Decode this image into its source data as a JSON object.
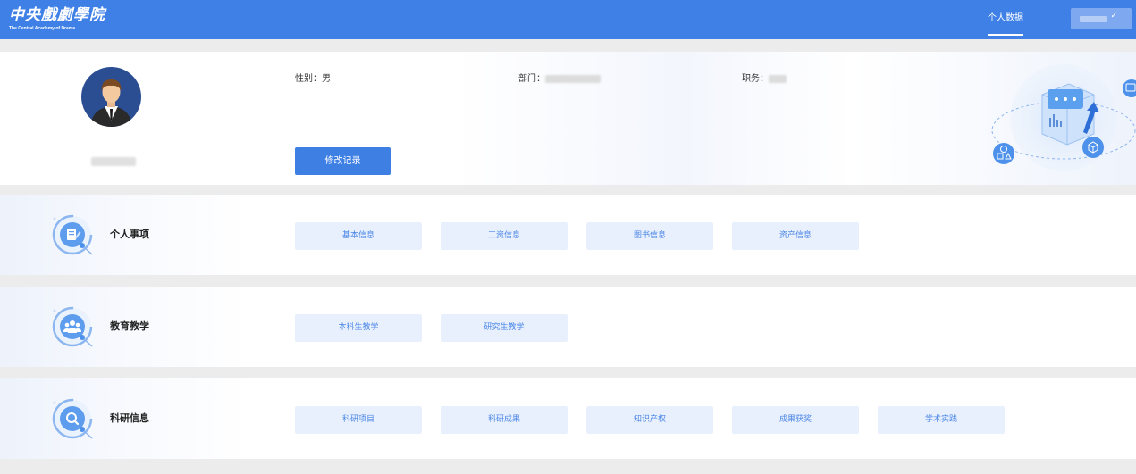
{
  "header": {
    "logo_cn": "中央戲劇學院",
    "logo_en": "The Central Academy of Drama",
    "nav_tab_label": "个人数据",
    "user_menu_icon": "check-icon"
  },
  "profile": {
    "gender_label": "性别：",
    "gender_value": "男",
    "department_label": "部门：",
    "position_label": "职务：",
    "edit_button": "修改记录"
  },
  "sections": [
    {
      "title": "个人事项",
      "icon": "document-icon",
      "items": [
        "基本信息",
        "工资信息",
        "图书信息",
        "资产信息"
      ]
    },
    {
      "title": "教育教学",
      "icon": "people-icon",
      "items": [
        "本科生教学",
        "研究生教学"
      ]
    },
    {
      "title": "科研信息",
      "icon": "search-icon",
      "items": [
        "科研项目",
        "科研成果",
        "知识产权",
        "成果获奖",
        "学术实践"
      ]
    }
  ],
  "colors": {
    "primary": "#3f80e6",
    "chip_bg": "#e8f0fd",
    "chip_text": "#4a86e6"
  }
}
